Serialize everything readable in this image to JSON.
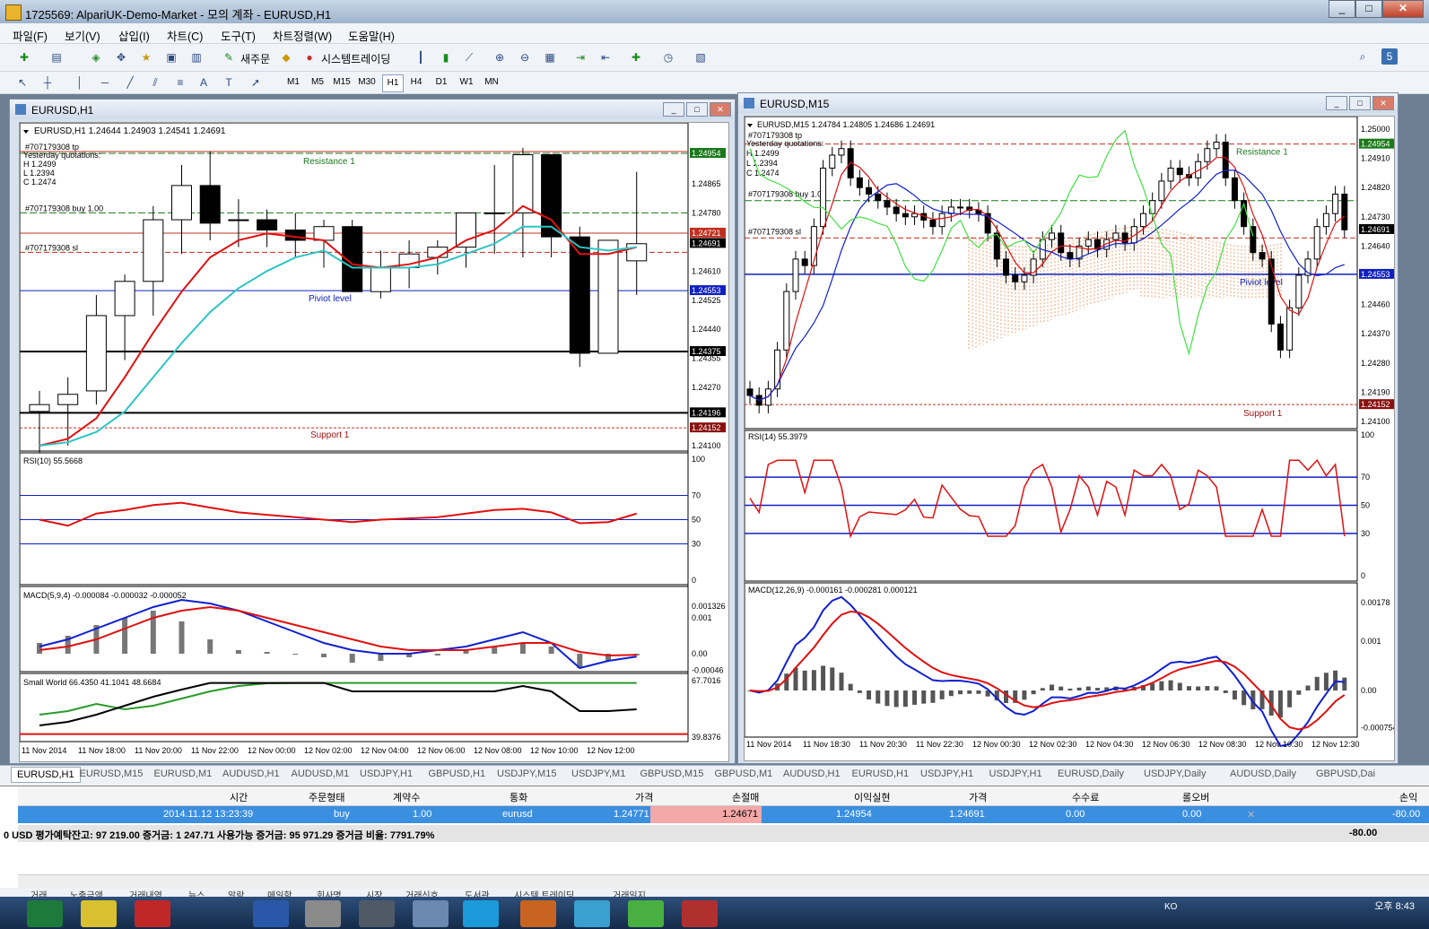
{
  "window": {
    "title": "1725569: AlpariUK-Demo-Market - 모의 계좌 - EURUSD,H1"
  },
  "menu": [
    "파일(F)",
    "보기(V)",
    "삽입(I)",
    "차트(C)",
    "도구(T)",
    "차트정렬(W)",
    "도움말(H)"
  ],
  "toolbar": {
    "new_order": "새주문",
    "autotrading": "시스템트레이딩",
    "timeframes": [
      "M1",
      "M5",
      "M15",
      "M30",
      "H1",
      "H4",
      "D1",
      "W1",
      "MN"
    ],
    "active_tf": "H1"
  },
  "chart_h1": {
    "title": "EURUSD,H1",
    "ohlc_header": "EURUSD,H1  1.24644 1.24903 1.24541 1.24691",
    "order_tp": "#707179308 tp",
    "yesterday": [
      "Yesterday quotations:",
      "H 1.2499",
      "L 1.2394",
      "C 1.2474"
    ],
    "order_buy": "#707179308 buy 1.00",
    "order_sl": "#707179308 sl",
    "resistance": "Resistance 1",
    "pivot": "Piviot level",
    "support": "Support 1",
    "price_ticks": [
      "1.24865",
      "1.24780",
      "1.24610",
      "1.24525",
      "1.24440",
      "1.24355",
      "1.24270",
      "1.24100"
    ],
    "price_tags": {
      "tp": "1.24954",
      "buy": "1.24721",
      "bid": "1.24691",
      "pivot": "1.24553",
      "black1": "1.24375",
      "black2": "1.24196",
      "sl": "1.24152"
    },
    "rsi_label": "RSI(10) 55.5668",
    "rsi_ticks": [
      "100",
      "70",
      "50",
      "30",
      "0"
    ],
    "macd_label": "MACD(5,9,4) -0.000084 -0.000032 -0.000052",
    "macd_ticks": [
      "0.001326",
      "0.001",
      "0.00",
      "-0.00046"
    ],
    "sw_label": "Small World 66.4350 41.1041 48.6684",
    "sw_ticks": [
      "67.7016",
      "39.8376"
    ],
    "time_labels": [
      "11 Nov 2014",
      "11 Nov 18:00",
      "11 Nov 20:00",
      "11 Nov 22:00",
      "12 Nov 00:00",
      "12 Nov 02:00",
      "12 Nov 04:00",
      "12 Nov 06:00",
      "12 Nov 08:00",
      "12 Nov 10:00",
      "12 Nov 12:00"
    ]
  },
  "chart_m15": {
    "title": "EURUSD,M15",
    "ohlc_header": "EURUSD,M15  1.24784 1.24805 1.24686 1.24691",
    "order_tp": "#707179308 tp",
    "yesterday": [
      "Yesterday quotations:",
      "H 1.2499",
      "L 1.2394",
      "C 1.2474"
    ],
    "order_buy": "#707179308 buy 1.00",
    "order_sl": "#707179308 sl",
    "resistance": "Resistance 1",
    "pivot": "Piviot level",
    "support": "Support 1",
    "price_ticks": [
      "1.25000",
      "1.24910",
      "1.24820",
      "1.24730",
      "1.24640",
      "1.24550",
      "1.24460",
      "1.24370",
      "1.24280",
      "1.24190",
      "1.24100"
    ],
    "price_tags": {
      "tp": "1.24954",
      "bid": "1.24691",
      "pivot": "1.24553",
      "sl": "1.24152"
    },
    "rsi_label": "RSI(14) 55.3979",
    "rsi_ticks": [
      "100",
      "70",
      "50",
      "30",
      "0"
    ],
    "macd_label": "MACD(12,26,9) -0.000161 -0.000281 0.000121",
    "macd_ticks": [
      "0.00178",
      "0.001",
      "0.00",
      "-0.000754"
    ],
    "time_labels": [
      "11 Nov 2014",
      "11 Nov 18:30",
      "11 Nov 20:30",
      "11 Nov 22:30",
      "12 Nov 00:30",
      "12 Nov 02:30",
      "12 Nov 04:30",
      "12 Nov 06:30",
      "12 Nov 08:30",
      "12 Nov 10:30",
      "12 Nov 12:30"
    ]
  },
  "chart_tabs": [
    "EURUSD,H1",
    "EURUSD,M15",
    "EURUSD,M1",
    "AUDUSD,H1",
    "AUDUSD,M1",
    "USDJPY,H1",
    "GBPUSD,H1",
    "USDJPY,M15",
    "USDJPY,M1",
    "GBPUSD,M15",
    "GBPUSD,M1",
    "AUDUSD,H1",
    "EURUSD,H1",
    "USDJPY,H1",
    "USDJPY,H1",
    "EURUSD,Daily",
    "USDJPY,Daily",
    "AUDUSD,Daily",
    "GBPUSD,Dai"
  ],
  "terminal": {
    "headers": [
      "시간",
      "주문형태",
      "계약수",
      "통화",
      "가격",
      "손절매",
      "이익실현",
      "가격",
      "수수료",
      "롤오버",
      "손익"
    ],
    "row": [
      "2014.11.12 13:23:39",
      "buy",
      "1.00",
      "eurusd",
      "1.24771",
      "1.24671",
      "1.24954",
      "1.24691",
      "0.00",
      "0.00",
      "-80.00"
    ],
    "balance": "0 USD  평가예탁잔고: 97 219.00  증거금: 1 247.71  사용가능 증거금: 95 971.29  증거금 비율: 7791.79%",
    "balance_pl": "-80.00",
    "tabs": [
      "거래",
      "노출금액",
      "거래내역",
      "뉴스",
      "알람",
      "메일함",
      "회사명",
      "시장",
      "거래신호",
      "도서관",
      "시스템 트레이딩",
      "거래일지"
    ]
  },
  "taskbar": {
    "time": "오후 8:43",
    "lang": "KO"
  },
  "colors": {
    "candle_up": "#ffffff",
    "candle_down": "#000000",
    "ma_fast": "#e01010",
    "ma_slow": "#2ec4c4",
    "pivot": "#1020c0",
    "resistance": "#1a7a1a",
    "support": "#a01010"
  }
}
